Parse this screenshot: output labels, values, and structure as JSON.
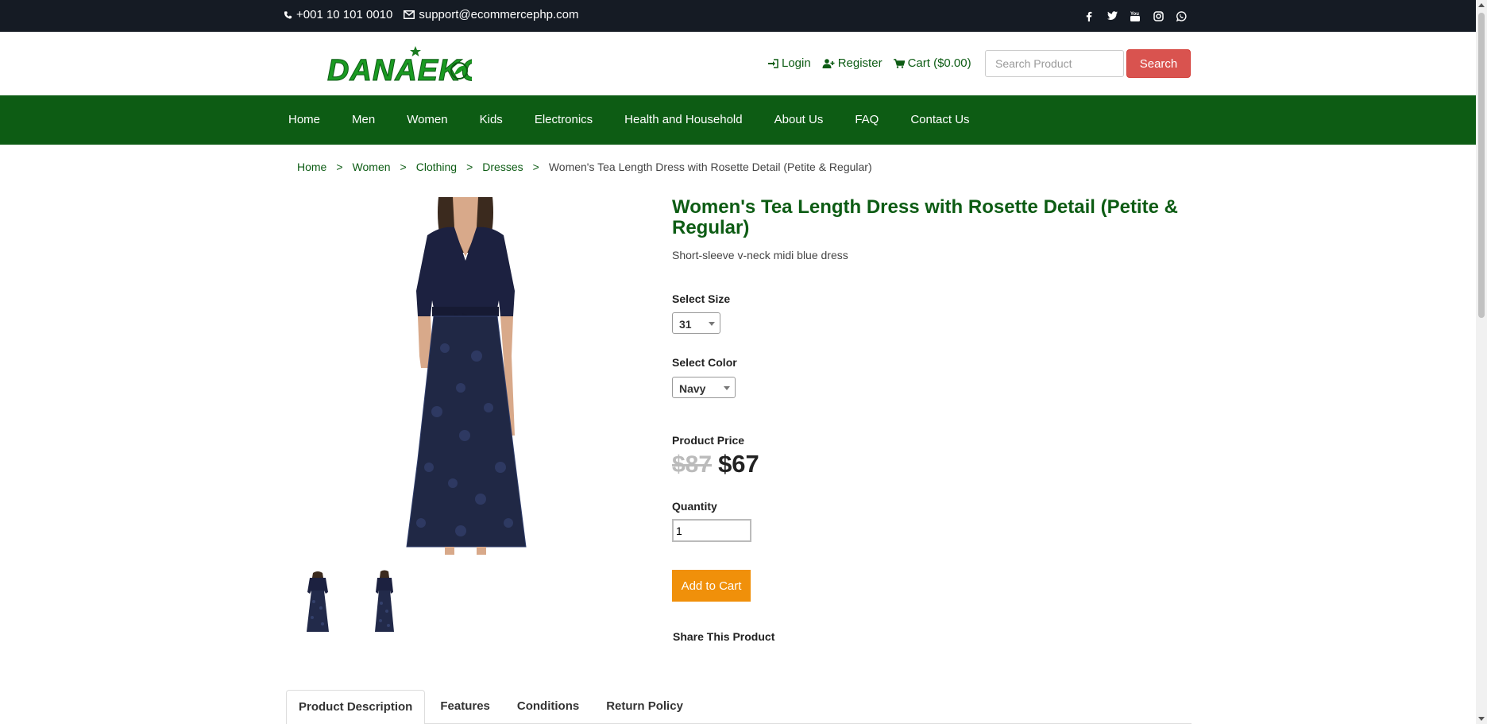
{
  "topbar": {
    "phone": "+001 10 101 0010",
    "email": "support@ecommercephp.com",
    "social_icons": [
      "facebook-icon",
      "twitter-icon",
      "youtube-icon",
      "instagram-icon",
      "whatsapp-icon"
    ]
  },
  "header": {
    "logo_text": "DANAEKO",
    "login_label": "Login",
    "register_label": "Register",
    "cart_label": "Cart ($0.00)",
    "search_placeholder": "Search Product",
    "search_button": "Search"
  },
  "nav": {
    "items": [
      "Home",
      "Men",
      "Women",
      "Kids",
      "Electronics",
      "Health and Household",
      "About Us",
      "FAQ",
      "Contact Us"
    ]
  },
  "breadcrumb": {
    "items": [
      "Home",
      "Women",
      "Clothing",
      "Dresses"
    ],
    "separator": ">",
    "current": "Women's Tea Length Dress with Rosette Detail (Petite & Regular)"
  },
  "product": {
    "title": "Women's Tea Length Dress with Rosette Detail (Petite & Regular)",
    "subtitle": "Short-sleeve v-neck midi blue dress",
    "size_label": "Select Size",
    "size_value": "31",
    "color_label": "Select Color",
    "color_value": "Navy",
    "price_label": "Product Price",
    "old_price": "$87",
    "new_price": "$67",
    "quantity_label": "Quantity",
    "quantity_value": "1",
    "add_to_cart": "Add to Cart",
    "share_label": "Share This Product"
  },
  "tabs": [
    "Product Description",
    "Features",
    "Conditions",
    "Return Policy"
  ],
  "colors": {
    "topbar_bg": "#151b24",
    "brand_green": "#0d5c14",
    "search_red": "#d9534f",
    "cart_orange": "#f0900a"
  }
}
